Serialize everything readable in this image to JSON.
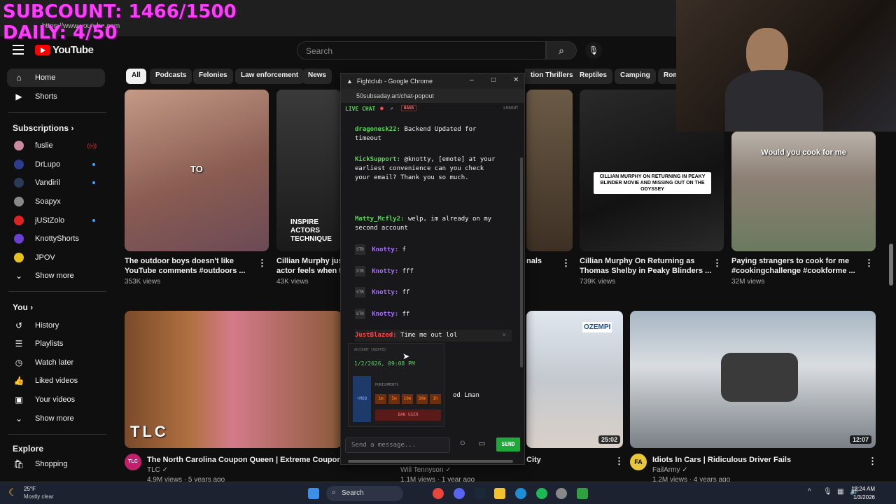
{
  "overlay": {
    "subcount": "SUBCOUNT: 1466/1500",
    "daily": "DAILY: 4/50"
  },
  "browser": {
    "url": "https://www.youtube.com"
  },
  "youtube": {
    "logo_text": "YouTube",
    "search_placeholder": "Search",
    "chips": [
      "All",
      "Podcasts",
      "Felonies",
      "Law enforcement",
      "News",
      "tion Thrillers",
      "Reptiles",
      "Camping",
      "Rom"
    ],
    "sidebar": {
      "home": "Home",
      "shorts": "Shorts",
      "subscriptions_header": "Subscriptions",
      "subscriptions": [
        "fuslie",
        "DrLupo",
        "Vandiril",
        "Soapyx",
        "jUStZolo",
        "KnottyShorts",
        "JPOV"
      ],
      "show_more_1": "Show more",
      "you_header": "You",
      "you_items": [
        "History",
        "Playlists",
        "Watch later",
        "Liked videos",
        "Your videos"
      ],
      "show_more_2": "Show more",
      "explore_header": "Explore",
      "shopping": "Shopping"
    },
    "videos": [
      {
        "title_1": "The outdoor boys doesn't like",
        "title_2": "YouTube comments #outdoors ...",
        "meta": "353K views",
        "overlay_text": "TO"
      },
      {
        "title_1": "Cillian Murphy just",
        "title_2": "actor feels when th",
        "meta": "43K views",
        "overlay_text": "INSPIRE ACTORS TECHNIQUE"
      },
      {
        "title_1": "nals",
        "title_2": "",
        "meta": ""
      },
      {
        "title_1": "Cillian Murphy On Returning as",
        "title_2": "Thomas Shelby in Peaky Blinders ...",
        "meta": "739K views",
        "overlay_text": "CILLIAN MURPHY ON RETURNING IN PEAKY BLINDER MOVIE AND MISSING OUT ON THE ODYSSEY"
      },
      {
        "title_1": "Paying strangers to cook for me",
        "title_2": "#cookingchallenge #cookforme ...",
        "meta": "32M views",
        "overlay_text": "Would you cook for me"
      },
      {
        "title": "The North Carolina Coupon Queen | Extreme Couponing",
        "channel": "TLC",
        "meta": "4.9M views · 5 years ago",
        "brand": "TLC"
      },
      {
        "title": "",
        "channel": "Will Tennyson",
        "meta": "1.1M views · 1 year ago"
      },
      {
        "title": "City",
        "duration": "25:02",
        "overlay_text": "OZEMPI"
      },
      {
        "title": "Idiots In Cars | Ridiculous Driver Fails",
        "channel": "FailArmy",
        "meta": "1.2M views · 4 years ago",
        "duration": "12:07"
      }
    ]
  },
  "chat_window": {
    "title": "Fightclub - Google Chrome",
    "url": "50subsaday.art/chat-popout",
    "live_chat": "LIVE CHAT",
    "bans": "BANS",
    "logout": "LOGOUT",
    "messages": [
      {
        "user": "dragonesk22:",
        "text": "Backend Updated for timeout"
      },
      {
        "user": "KickSupport:",
        "text": "@knotty, [emote] at your earliest convenience can you check your email? Thank you so much."
      },
      {
        "user": "Matty_Mcfly2:",
        "text": "welp, im already on my second account"
      },
      {
        "badge": "STR",
        "user": "Knotty:",
        "text": "f"
      },
      {
        "badge": "STR",
        "user": "Knotty:",
        "text": "fff"
      },
      {
        "badge": "STR",
        "user": "Knotty:",
        "text": "ff"
      },
      {
        "badge": "STR",
        "user": "Knotty:",
        "text": "ff"
      },
      {
        "user": "JustBlazed:",
        "text": "Time me out lol"
      },
      {
        "user": "",
        "text": "od Lman"
      }
    ],
    "popup": {
      "account_created_label": "ACCOUNT CREATED",
      "account_created_value": "1/2/2026, 09:08 PM",
      "mod_label": "+MOD",
      "punishments_label": "PUNISHMENTS",
      "durations": [
        "1m",
        "5m",
        "10m",
        "30m",
        "1h"
      ],
      "ban_label": "BAN USER"
    },
    "input_placeholder": "Send a message...",
    "send_label": "SEND"
  },
  "taskbar": {
    "weather_temp": "25°F",
    "weather_desc": "Mostly clear",
    "search": "Search",
    "time": "12:24 AM",
    "date": "1/3/2026"
  },
  "colors": {
    "overlay_magenta": "#ff3cff",
    "yt_red": "#ff0000",
    "chat_green": "#5dd35d",
    "send_green": "#1fa83a"
  }
}
